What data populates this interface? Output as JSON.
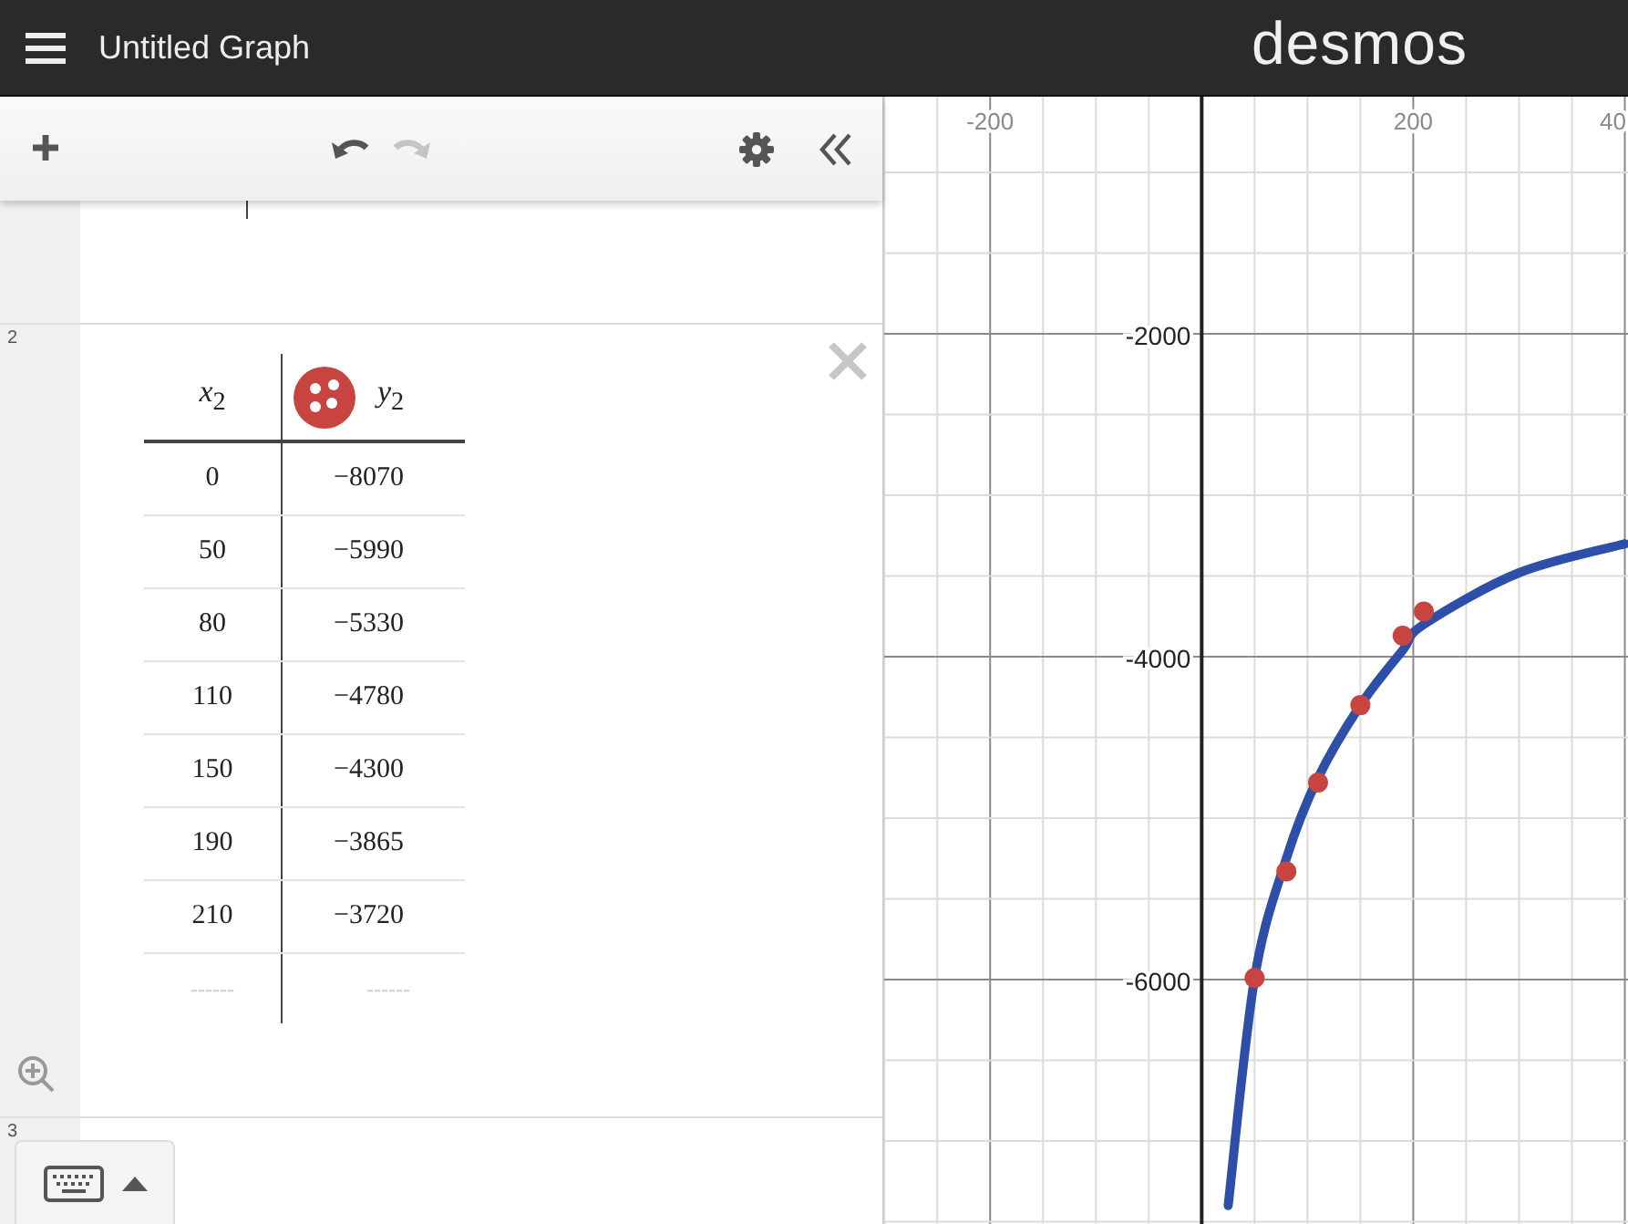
{
  "header": {
    "title": "Untitled Graph",
    "logo": "desmos"
  },
  "toolbar": [
    {
      "kind": "add",
      "disabled": false
    },
    {
      "kind": "undo",
      "disabled": false
    },
    {
      "kind": "redo",
      "disabled": true
    },
    {
      "kind": "settings",
      "disabled": false
    },
    {
      "kind": "collapse",
      "disabled": false
    }
  ],
  "expressions": [
    {
      "kind": "blank"
    },
    {
      "kind": "table",
      "number": "2",
      "columns": [
        {
          "header": "*x*$_{2}$"
        },
        {
          "header": "*y*$_{2}$",
          "color": "#c74440"
        }
      ],
      "rows": [
        [
          "0",
          "−8070"
        ],
        [
          "50",
          "−5990"
        ],
        [
          "80",
          "−5330"
        ],
        [
          "110",
          "−4780"
        ],
        [
          "150",
          "−4300"
        ],
        [
          "190",
          "−3865"
        ],
        [
          "210",
          "−3720"
        ]
      ],
      "empty_row": [
        {
          "placeholder": "------"
        },
        {
          "placeholder": "------"
        }
      ]
    },
    {
      "kind": "blank",
      "number": "3"
    }
  ],
  "graph": {
    "edge_label": "40",
    "chart_data": {
      "type": "scatter",
      "x": [
        25,
        50,
        80,
        110,
        150,
        190,
        210,
        300,
        400
      ],
      "series": [
        {
          "color": "#c74440",
          "values": [
            null,
            -5990,
            -5330,
            -4780,
            -4300,
            -3870,
            -3720,
            null,
            null
          ]
        },
        {
          "type": "line",
          "color": "#2d4fa8",
          "values": [
            -7400,
            -5990,
            -5250,
            -4750,
            -4300,
            -3960,
            -3800,
            -3480,
            -3300
          ]
        }
      ],
      "grid": true,
      "xlim": [
        -1136,
        403
      ],
      "ylim": [
        -7514,
        -531
      ],
      "xticks": [
        -200,
        200
      ],
      "yticks": [
        {
          "value": -2000,
          "label": "-2000"
        },
        {
          "value": -4000,
          "label": "-4000"
        },
        {
          "value": -6000,
          "label": "-6000"
        }
      ]
    }
  }
}
